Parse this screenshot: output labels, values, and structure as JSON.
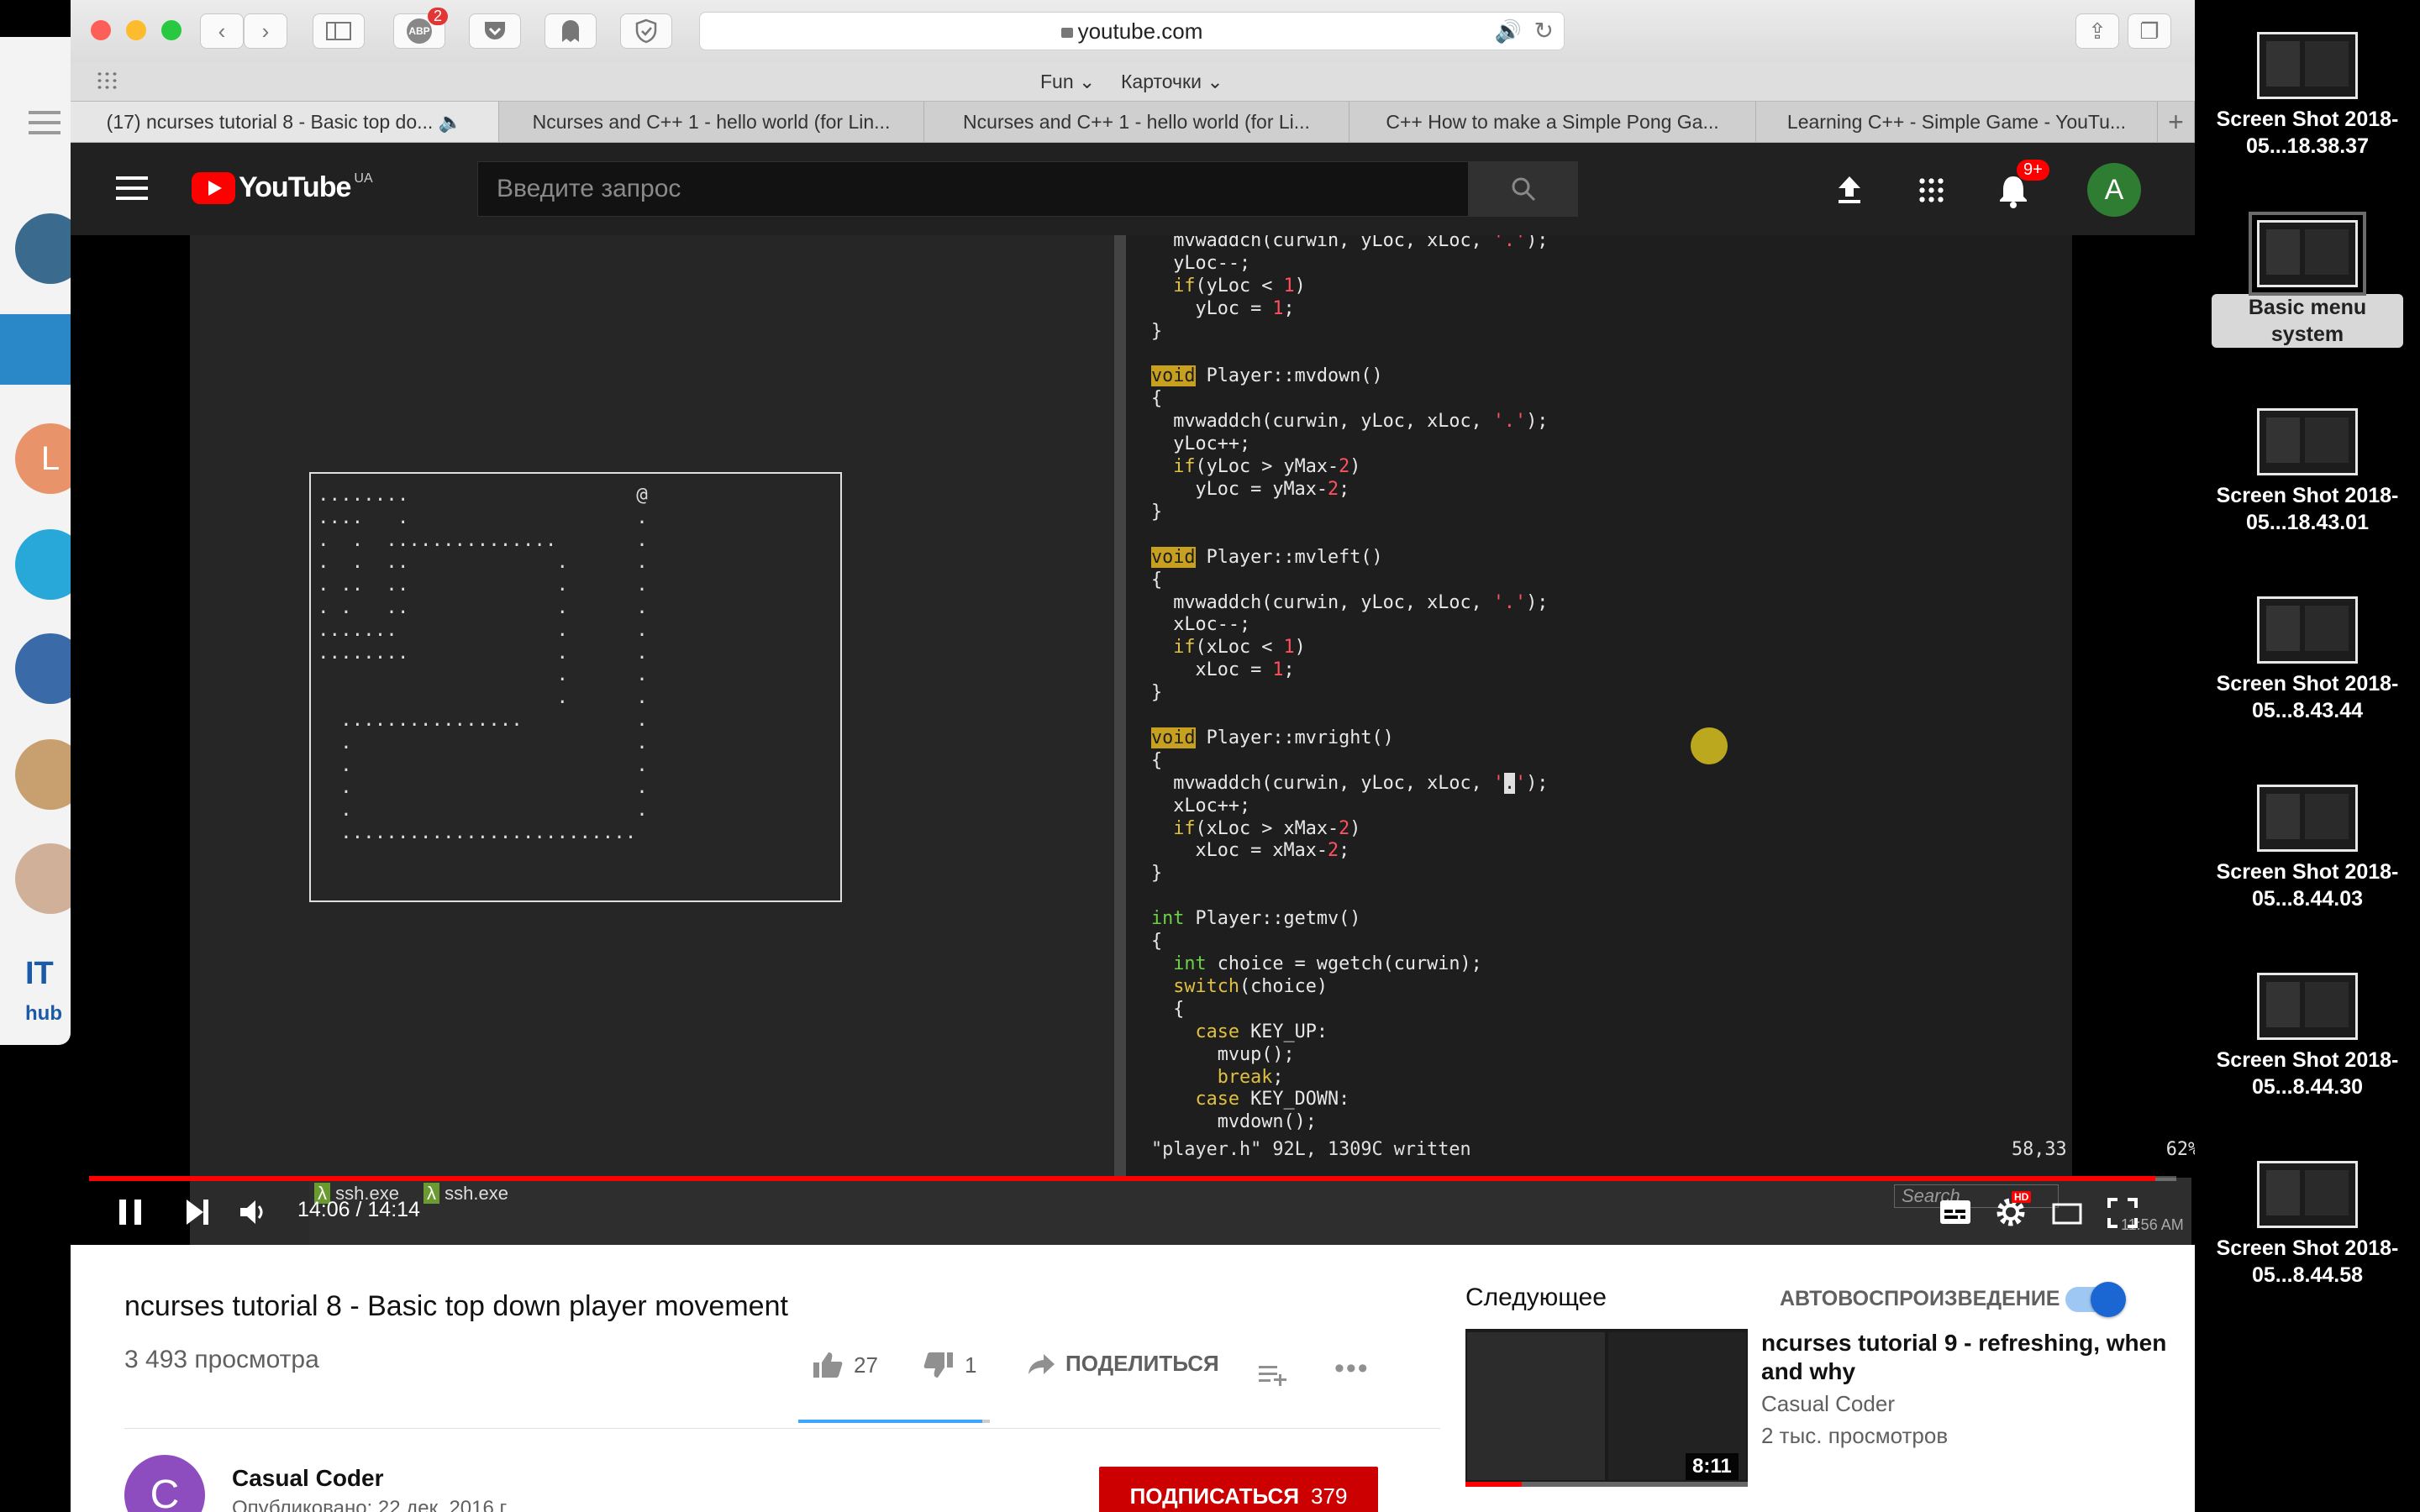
{
  "browser": {
    "url": "youtube.com",
    "abp_badge": "2",
    "bookmarks": [
      "Fun",
      "Карточки"
    ],
    "tabs": [
      "(17) ncurses tutorial 8 - Basic top do...",
      "Ncurses and C++ 1 - hello world (for Lin...",
      "Ncurses and C++ 1 - hello world (for Li...",
      "C++ How to make a Simple Pong Ga...",
      "Learning C++ - Simple Game - YouTu..."
    ]
  },
  "youtube": {
    "logo_text": "YouTube",
    "region": "UA",
    "search_placeholder": "Введите запрос",
    "notifications": "9+",
    "account_initial": "A"
  },
  "video": {
    "game_text": "........                    @\n....   .                    .\n.  .  ...............       .\n.  .  ..             .      .\n. ..  ..             .      .\n. .   ..             .      .\n.......              .      .\n........             .      .\n                     .      .\n                     .      .\n  ................          .\n  .                         .\n  .                         .\n  .                         .\n  .                         .\n  ..........................",
    "status_left": "\"player.h\" 92L, 1309C written",
    "status_right": "58,33         62%",
    "taskbar_items": [
      "ssh.exe",
      "ssh.exe"
    ],
    "taskbar_search": "Search",
    "taskbar_clock": "11:56 AM",
    "time_display": "14:06 / 14:14",
    "progress": 0.99
  },
  "info": {
    "title": "ncurses tutorial 8 - Basic top down player movement",
    "views": "3 493 просмотра",
    "likes": "27",
    "dislikes": "1",
    "like_ratio": 0.96,
    "share": "ПОДЕЛИТЬСЯ",
    "channel": "Casual Coder",
    "channel_initial": "C",
    "published": "Опубликовано: 22 дек. 2016 г.",
    "subscribe": "ПОДПИСАТЬСЯ",
    "subscribers": "379"
  },
  "sidebar": {
    "up_next": "Следующее",
    "autoplay": "АВТОВОСПРОИЗВЕДЕНИЕ",
    "next_title": "ncurses tutorial 9 - refreshing, when and why",
    "next_channel": "Casual Coder",
    "next_views": "2 тыс. просмотров",
    "next_duration": "8:11"
  },
  "desktop": [
    {
      "label": "Screen Shot 2018-05...18.38.37"
    },
    {
      "label": "Basic menu system"
    },
    {
      "label": "Screen Shot 2018-05...18.43.01"
    },
    {
      "label": "Screen Shot 2018-05...8.43.44"
    },
    {
      "label": "Screen Shot 2018-05...8.44.03"
    },
    {
      "label": "Screen Shot 2018-05...8.44.30"
    },
    {
      "label": "Screen Shot 2018-05...8.44.58"
    }
  ],
  "left_strip": {
    "avatar_letter": "L",
    "it_label": "IT",
    "hub_label": "hub"
  },
  "colors": {
    "accent": "#ff0000",
    "subscribe": "#cc0000",
    "autoplay": "#1a66d2",
    "code_keyword": "#c8a020",
    "code_type": "#6fcf48"
  }
}
